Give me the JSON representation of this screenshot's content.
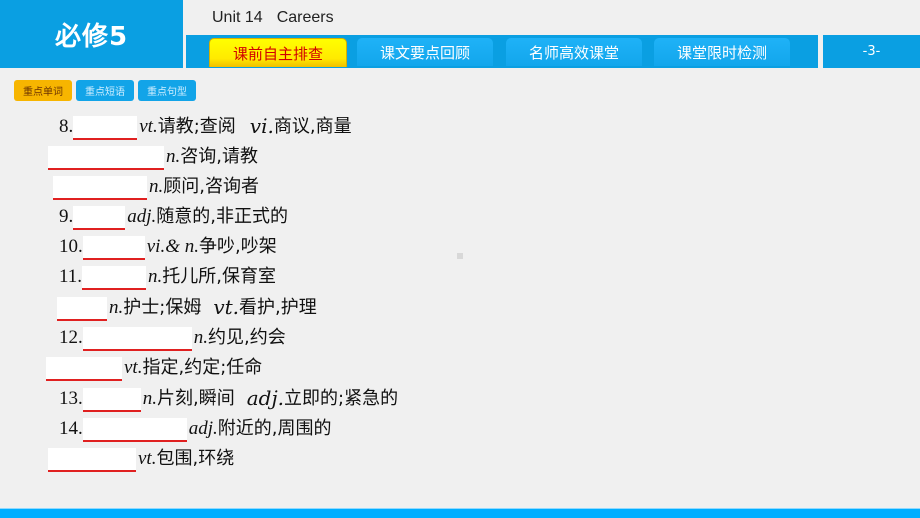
{
  "header": {
    "book_title": "必修5",
    "unit_label": "Unit 14",
    "unit_name": "Careers",
    "page_number": "-3-"
  },
  "nav_tabs": [
    {
      "label": "课前自主排查",
      "active": true
    },
    {
      "label": "课文要点回顾",
      "active": false
    },
    {
      "label": "名师高效课堂",
      "active": false
    },
    {
      "label": "课堂限时检测",
      "active": false
    }
  ],
  "sub_tabs": [
    {
      "label": "重点单词",
      "active": true
    },
    {
      "label": "重点短语",
      "active": false
    },
    {
      "label": "重点句型",
      "active": false
    }
  ],
  "vocab_items": [
    {
      "number": "8.",
      "pos1": "vt.",
      "meaning1": "请教;查阅",
      "pos2": "vi.",
      "meaning2": "商议,商量"
    },
    {
      "number": "",
      "pos1": "n.",
      "meaning1": "咨询,请教"
    },
    {
      "number": "",
      "pos1": "n.",
      "meaning1": "顾问,咨询者"
    },
    {
      "number": "9.",
      "pos1": "adj.",
      "meaning1": "随意的,非正式的"
    },
    {
      "number": "10.",
      "pos1": "vi.& n.",
      "meaning1": "争吵,吵架"
    },
    {
      "number": "11.",
      "pos1": "n.",
      "meaning1": "托儿所,保育室"
    },
    {
      "number": "",
      "pos1": "n.",
      "meaning1": "护士;保姆",
      "pos2": "vt.",
      "meaning2": "看护,护理"
    },
    {
      "number": "12.",
      "pos1": "n.",
      "meaning1": "约见,约会"
    },
    {
      "number": "",
      "pos1": "vt.",
      "meaning1": "指定,约定;任命"
    },
    {
      "number": "13.",
      "pos1": "n.",
      "meaning1": "片刻,瞬间",
      "pos2": "adj.",
      "meaning2": "立即的;紧急的"
    },
    {
      "number": "14.",
      "pos1": "adj.",
      "meaning1": "附近的,周围的"
    },
    {
      "number": "",
      "pos1": "vt.",
      "meaning1": "包围,环绕"
    }
  ],
  "colors": {
    "brand_blue": "#0a9fe2",
    "active_tab_yellow": "#ffff00",
    "active_tab_text": "#d00000",
    "active_subtab": "#f7b500",
    "answer_underline": "#e02020"
  }
}
